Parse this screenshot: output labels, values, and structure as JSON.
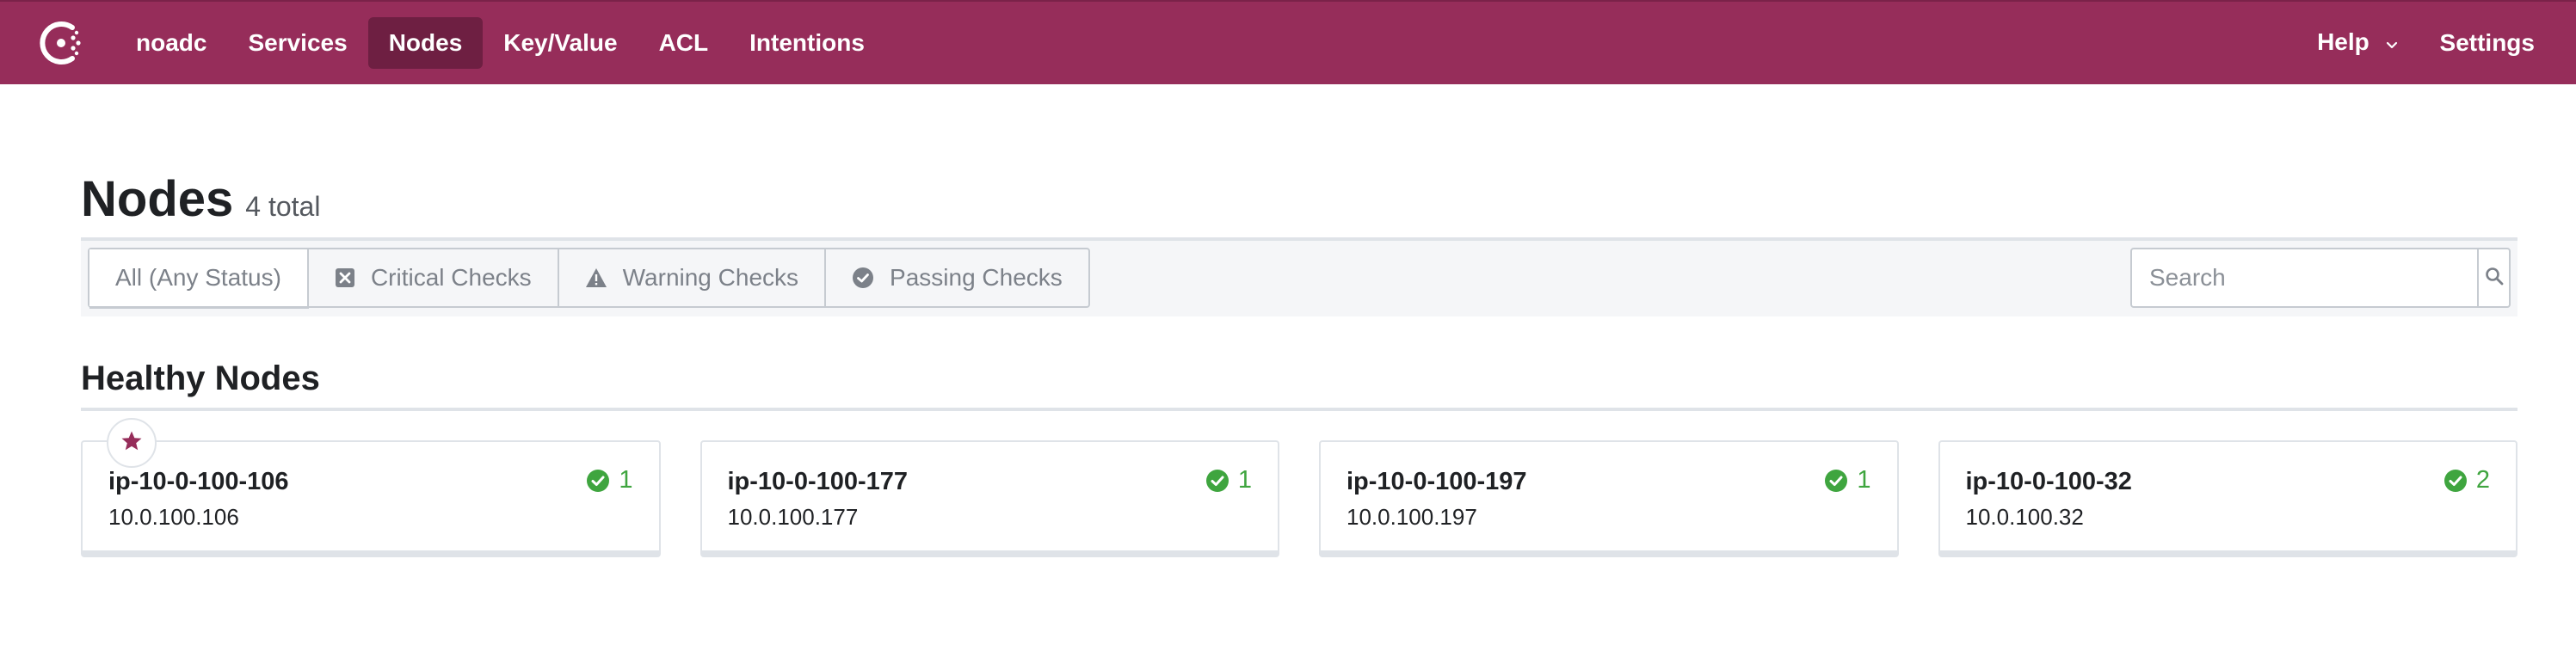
{
  "nav": {
    "datacenter": "noadc",
    "items": [
      {
        "label": "Services",
        "active": false
      },
      {
        "label": "Nodes",
        "active": true
      },
      {
        "label": "Key/Value",
        "active": false
      },
      {
        "label": "ACL",
        "active": false
      },
      {
        "label": "Intentions",
        "active": false
      }
    ],
    "help_label": "Help",
    "settings_label": "Settings"
  },
  "page": {
    "title": "Nodes",
    "count": "4 total"
  },
  "filters": {
    "all": "All (Any Status)",
    "critical": "Critical Checks",
    "warning": "Warning Checks",
    "passing": "Passing Checks"
  },
  "search": {
    "placeholder": "Search",
    "value": ""
  },
  "section": {
    "title": "Healthy Nodes"
  },
  "nodes": [
    {
      "name": "ip-10-0-100-106",
      "address": "10.0.100.106",
      "passing": "1",
      "leader": true
    },
    {
      "name": "ip-10-0-100-177",
      "address": "10.0.100.177",
      "passing": "1",
      "leader": false
    },
    {
      "name": "ip-10-0-100-197",
      "address": "10.0.100.197",
      "passing": "1",
      "leader": false
    },
    {
      "name": "ip-10-0-100-32",
      "address": "10.0.100.32",
      "passing": "2",
      "leader": false
    }
  ],
  "colors": {
    "brand": "#962d5a",
    "brand_active": "#6e1f42",
    "passing": "#3fa53f"
  },
  "icons": {
    "logo": "consul-logo",
    "critical": "critical-x-icon",
    "warning": "warning-triangle-icon",
    "passing": "passing-check-icon",
    "search": "search-icon",
    "leader": "star-icon"
  }
}
